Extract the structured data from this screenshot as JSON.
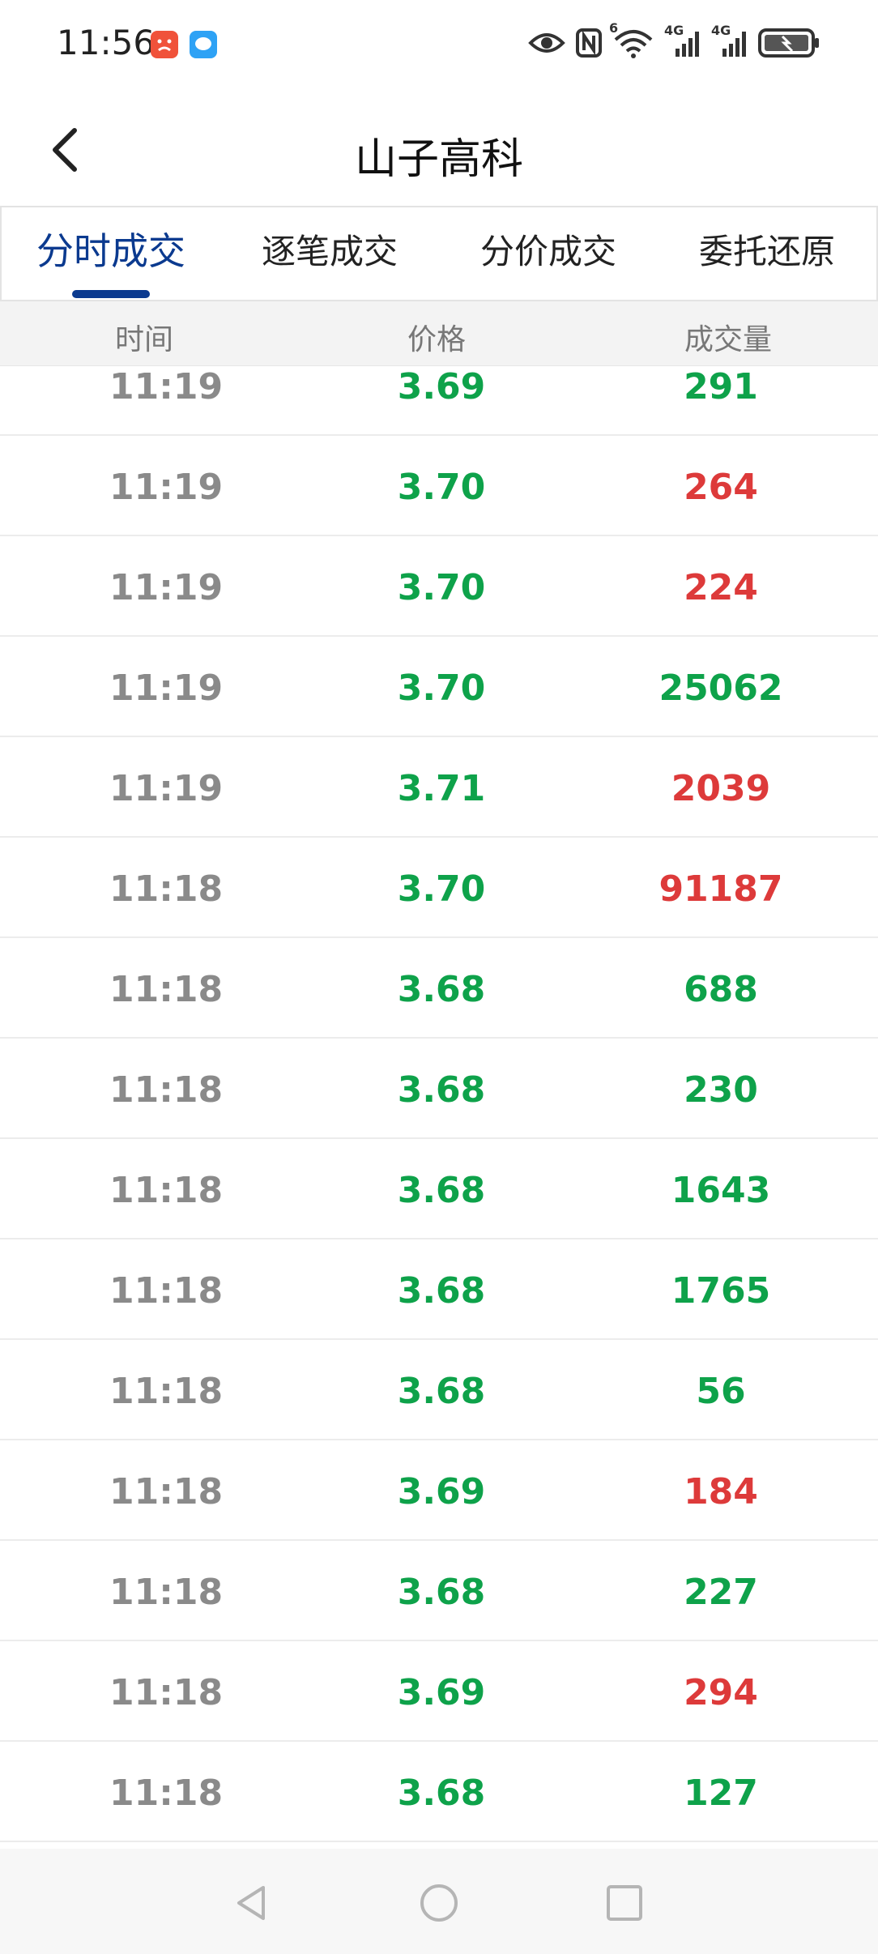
{
  "status_bar": {
    "time": "11:56",
    "app_icons": [
      "red-app-icon",
      "blue-chat-icon"
    ],
    "indicators": [
      "eye-icon",
      "nfc-icon",
      "wifi-6-icon",
      "4g-signal-icon",
      "4g-signal-icon",
      "battery-icon"
    ],
    "network_labels": [
      "6",
      "4G",
      "4G"
    ]
  },
  "header": {
    "title": "山子高科"
  },
  "tabs": [
    {
      "label": "分时成交",
      "active": true
    },
    {
      "label": "逐笔成交",
      "active": false
    },
    {
      "label": "分价成交",
      "active": false
    },
    {
      "label": "委托还原",
      "active": false
    }
  ],
  "table": {
    "columns": [
      "时间",
      "价格",
      "成交量"
    ],
    "rows": [
      {
        "time": "11:19",
        "price": "3.69",
        "volume": "291",
        "direction": "down"
      },
      {
        "time": "11:19",
        "price": "3.70",
        "volume": "264",
        "direction": "up"
      },
      {
        "time": "11:19",
        "price": "3.70",
        "volume": "224",
        "direction": "up"
      },
      {
        "time": "11:19",
        "price": "3.70",
        "volume": "25062",
        "direction": "down"
      },
      {
        "time": "11:19",
        "price": "3.71",
        "volume": "2039",
        "direction": "up"
      },
      {
        "time": "11:18",
        "price": "3.70",
        "volume": "91187",
        "direction": "up"
      },
      {
        "time": "11:18",
        "price": "3.68",
        "volume": "688",
        "direction": "down"
      },
      {
        "time": "11:18",
        "price": "3.68",
        "volume": "230",
        "direction": "down"
      },
      {
        "time": "11:18",
        "price": "3.68",
        "volume": "1643",
        "direction": "down"
      },
      {
        "time": "11:18",
        "price": "3.68",
        "volume": "1765",
        "direction": "down"
      },
      {
        "time": "11:18",
        "price": "3.68",
        "volume": "56",
        "direction": "down"
      },
      {
        "time": "11:18",
        "price": "3.69",
        "volume": "184",
        "direction": "up"
      },
      {
        "time": "11:18",
        "price": "3.68",
        "volume": "227",
        "direction": "down"
      },
      {
        "time": "11:18",
        "price": "3.69",
        "volume": "294",
        "direction": "up"
      },
      {
        "time": "11:18",
        "price": "3.68",
        "volume": "127",
        "direction": "down"
      }
    ]
  },
  "colors": {
    "up": "#dd3a3a",
    "down": "#0ea24a",
    "time": "#8a8a8a",
    "accent": "#0b3a8f"
  },
  "nav_bar": {
    "buttons": [
      "back-triangle-icon",
      "home-circle-icon",
      "recents-square-icon"
    ]
  }
}
